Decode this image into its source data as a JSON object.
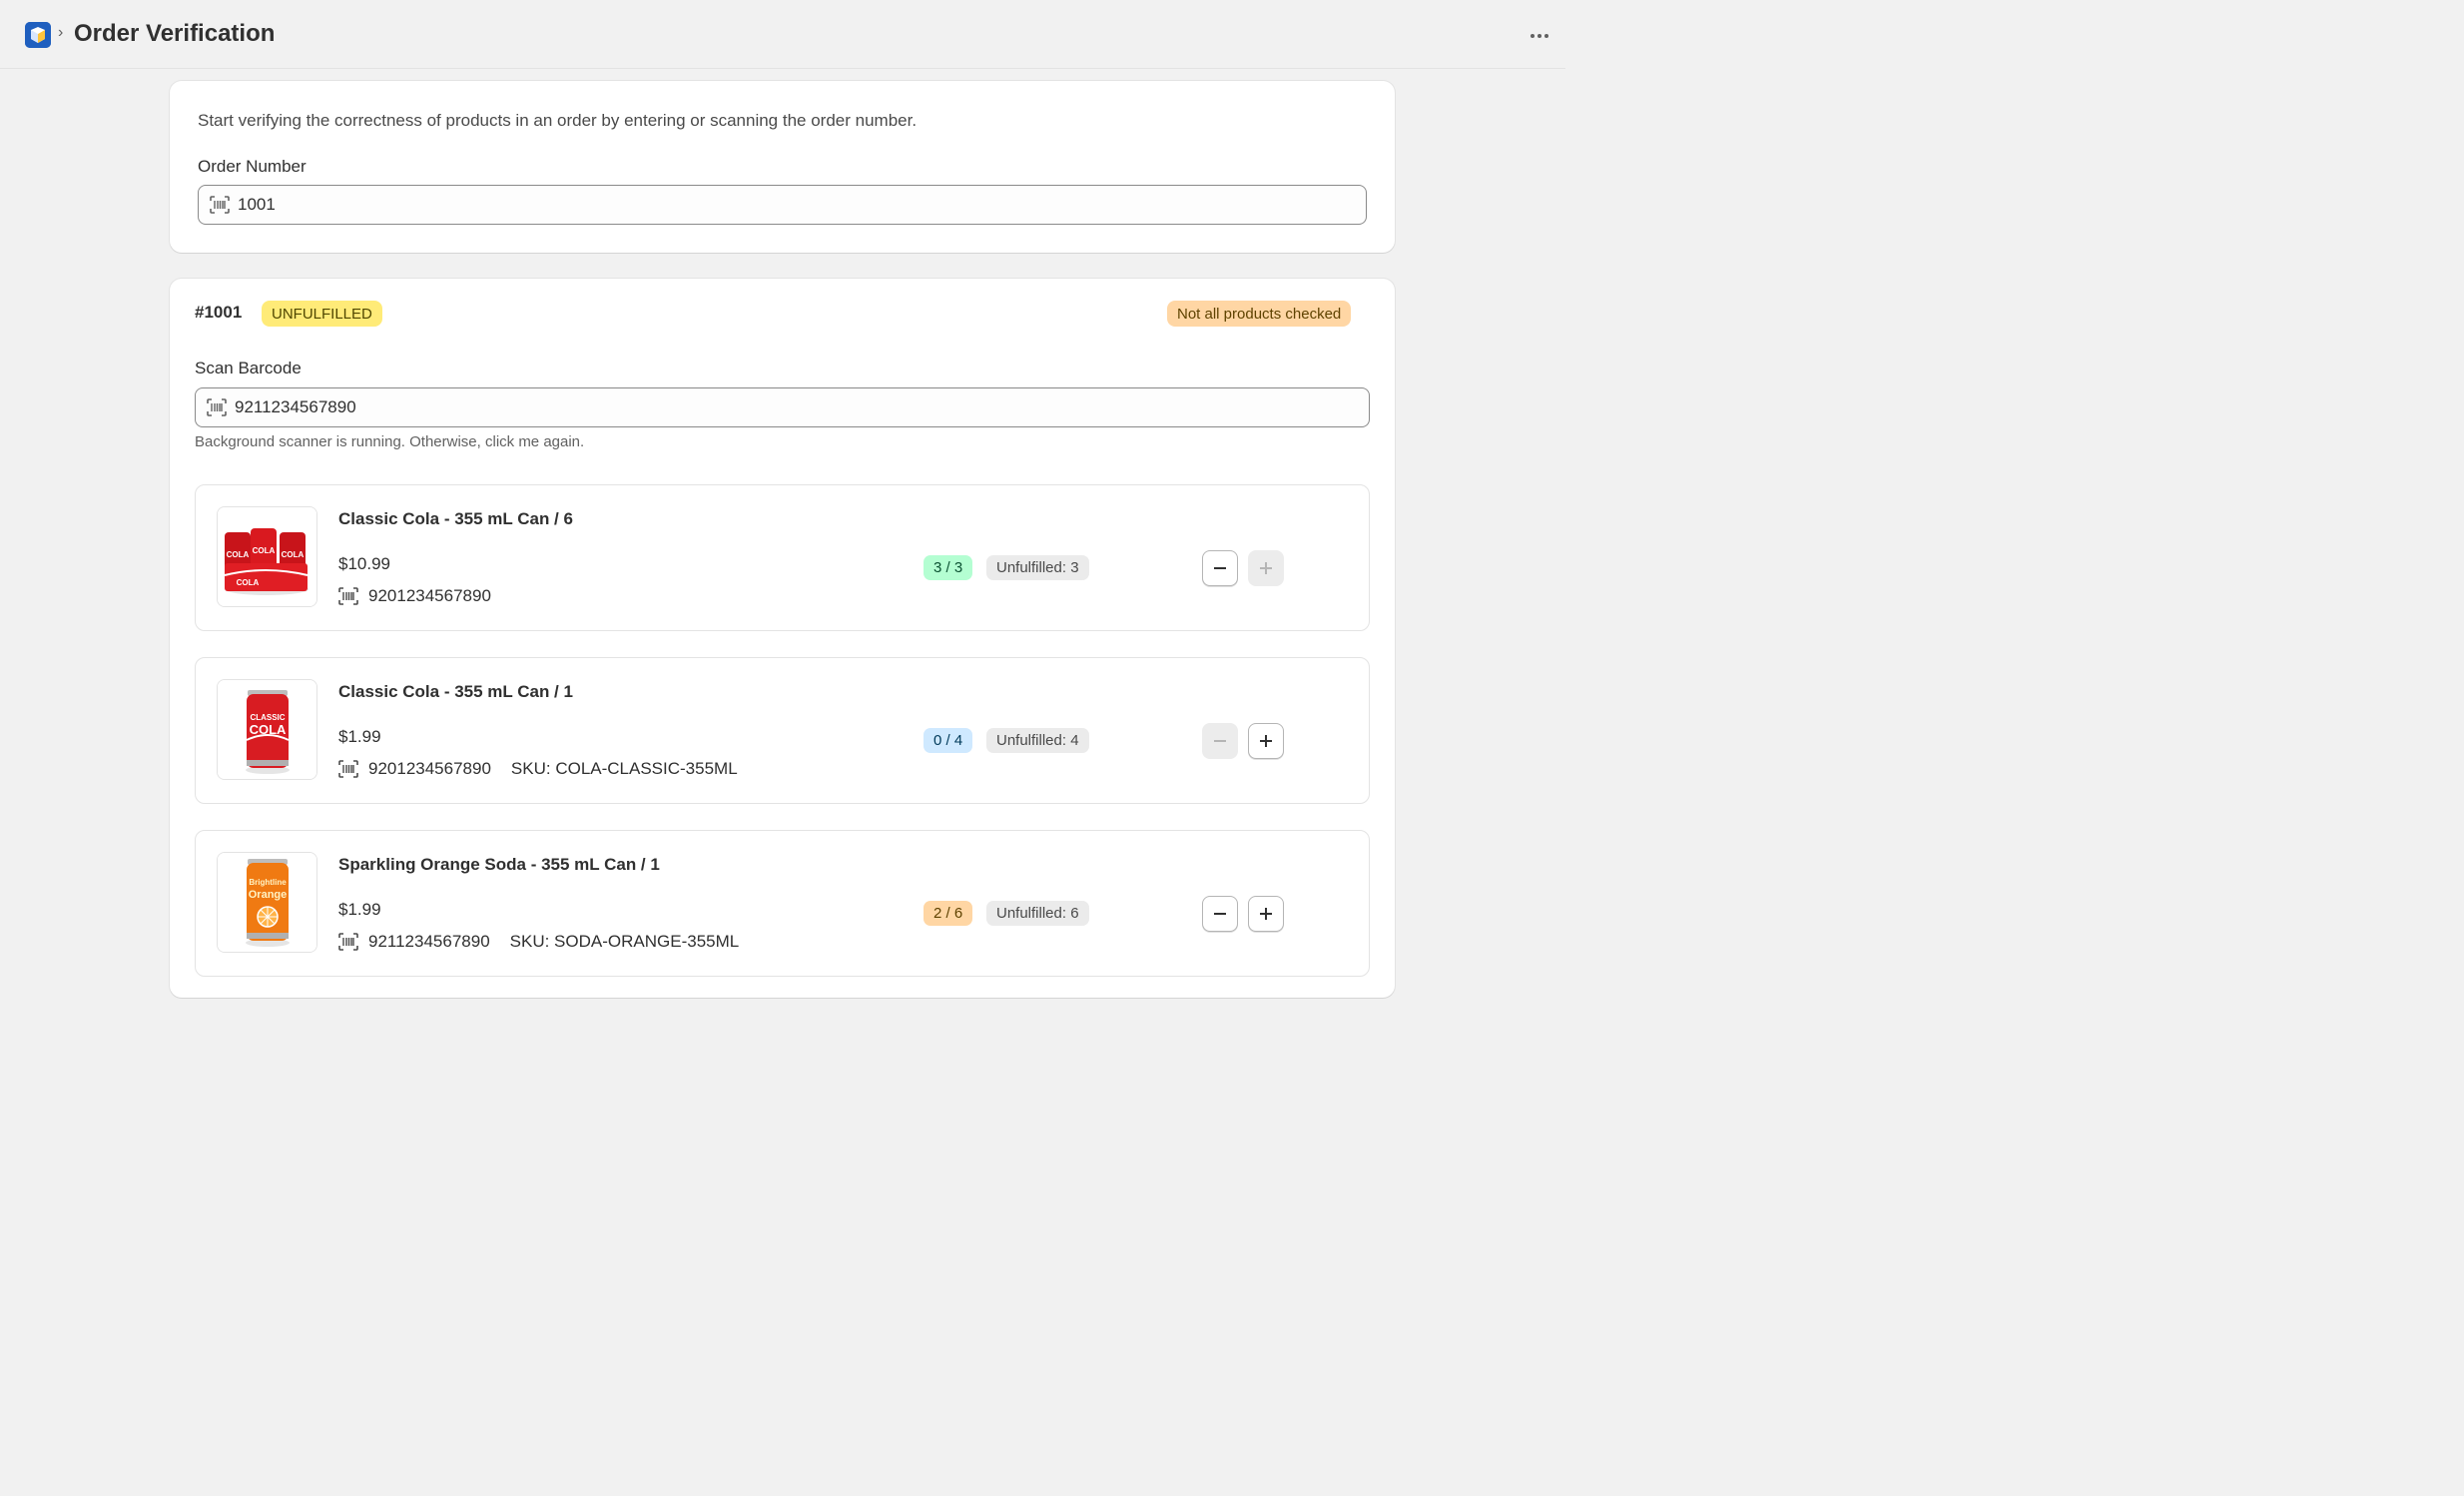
{
  "header": {
    "app_icon": "app-logo-icon",
    "separator": "›",
    "title": "Order Verification",
    "more_icon": "more-horizontal-icon"
  },
  "lookup": {
    "description": "Start verifying the correctness of products in an order by entering or scanning the order number.",
    "order_number_label": "Order Number",
    "order_number_value": "1001",
    "field_icon": "barcode-icon"
  },
  "order": {
    "number": "#1001",
    "fulfillment_badge": "UNFULFILLED",
    "check_status_badge": "Not all products checked",
    "scan_label": "Scan Barcode",
    "scan_value": "9211234567890",
    "scan_help": "Background scanner is running. Otherwise, click me again.",
    "items": [
      {
        "title": "Classic Cola - 355 mL Can / 6",
        "price": "$10.99",
        "barcode": "9201234567890",
        "sku": "",
        "checked": "3 / 3",
        "unfulfilled": "Unfulfilled: 3",
        "checked_color": "#b4fed2",
        "checked_text_color": "#0c5132",
        "minus_enabled": true,
        "plus_enabled": false,
        "image": "cola-six-pack"
      },
      {
        "title": "Classic Cola - 355 mL Can / 1",
        "price": "$1.99",
        "barcode": "9201234567890",
        "sku": "SKU: COLA-CLASSIC-355ML",
        "checked": "0 / 4",
        "unfulfilled": "Unfulfilled: 4",
        "checked_color": "#cfe9ff",
        "checked_text_color": "#003a5a",
        "minus_enabled": false,
        "plus_enabled": true,
        "image": "cola-can"
      },
      {
        "title": "Sparkling Orange Soda - 355 mL Can / 1",
        "price": "$1.99",
        "barcode": "9211234567890",
        "sku": "SKU: SODA-ORANGE-355ML",
        "checked": "2 / 6",
        "unfulfilled": "Unfulfilled: 6",
        "checked_color": "#ffd6a4",
        "checked_text_color": "#5e4200",
        "minus_enabled": true,
        "plus_enabled": true,
        "image": "orange-soda-can"
      }
    ]
  },
  "colors": {
    "accent": "#1f5fbf",
    "unfulfilled_badge": "#ffeb78",
    "warning_badge": "#ffd6a4"
  }
}
